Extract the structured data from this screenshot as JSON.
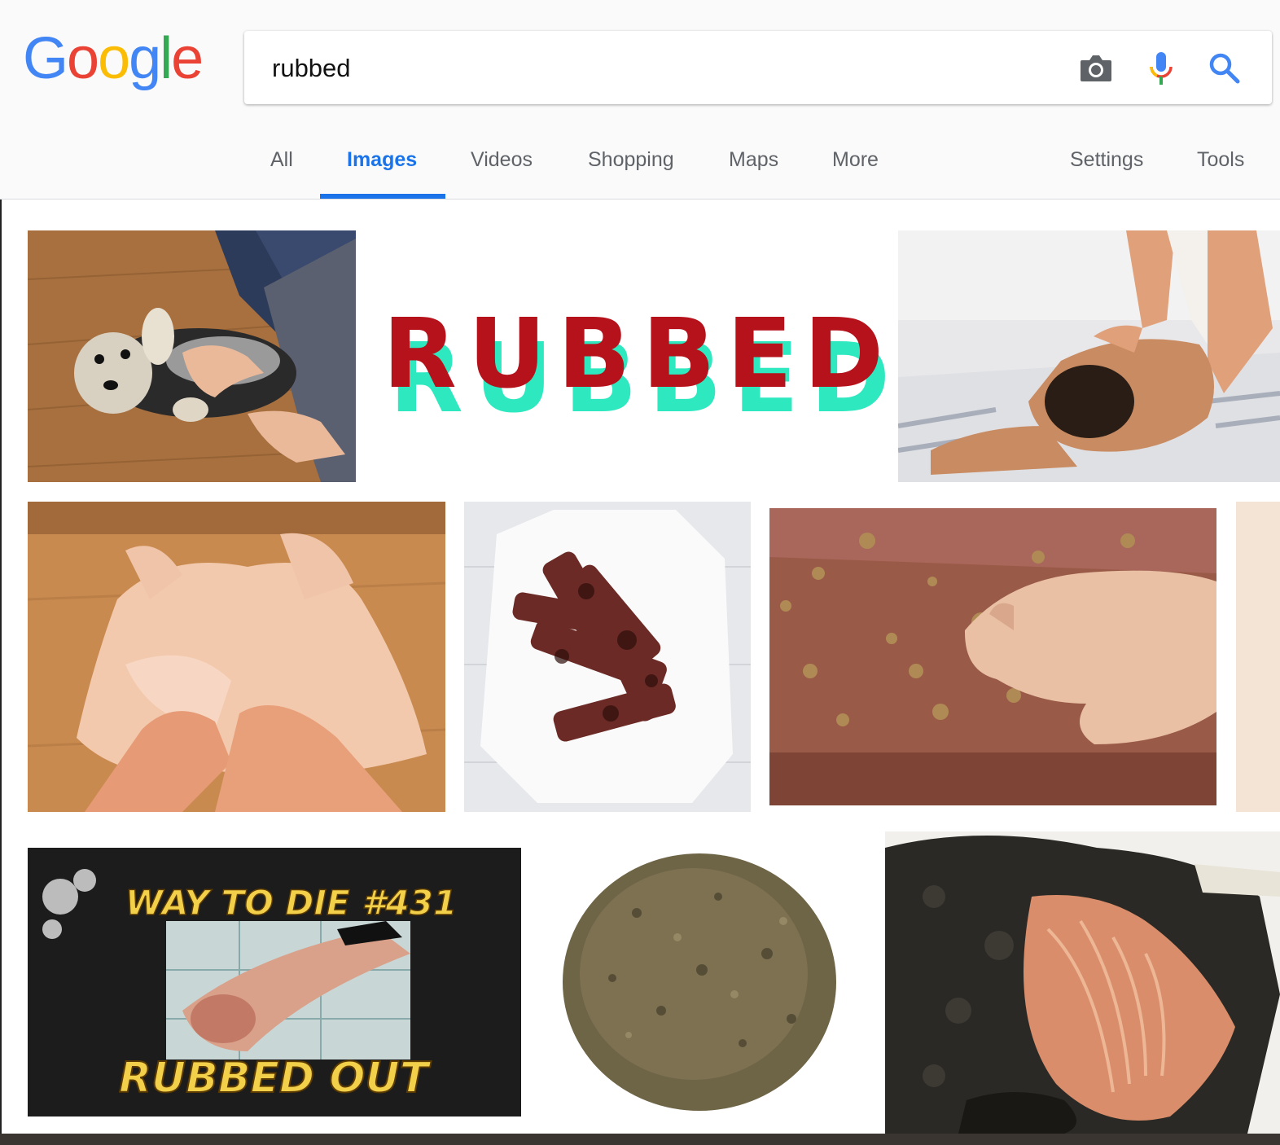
{
  "logo": {
    "letters": [
      "G",
      "o",
      "o",
      "g",
      "l",
      "e"
    ],
    "colors": [
      "#4285F4",
      "#EA4335",
      "#FBBC05",
      "#4285F4",
      "#34A853",
      "#EA4335"
    ]
  },
  "search": {
    "value": "rubbed",
    "icons": [
      "camera-icon",
      "microphone-icon",
      "search-icon"
    ]
  },
  "tabs": [
    {
      "label": "All"
    },
    {
      "label": "Images",
      "active": true
    },
    {
      "label": "Videos"
    },
    {
      "label": "Shopping"
    },
    {
      "label": "Maps"
    },
    {
      "label": "More"
    }
  ],
  "right_tabs": [
    {
      "label": "Settings"
    },
    {
      "label": "Tools"
    }
  ],
  "results": {
    "rubbed_logo_text": "RUBBED",
    "video_title": "WAY TO DIE #431",
    "video_subtitle": "RUBBED OUT"
  },
  "colors": {
    "accent": "#1a73e8",
    "rubbed_red": "#b5121b",
    "rubbed_teal": "#2ee8c0"
  }
}
